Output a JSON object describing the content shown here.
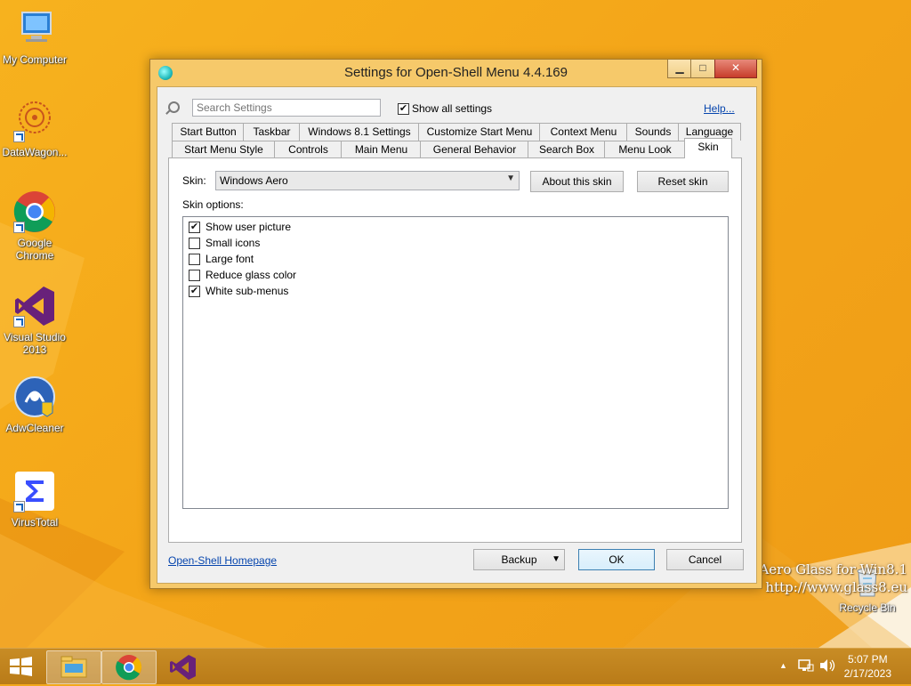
{
  "desktop": {
    "icons": [
      {
        "name": "my-computer",
        "label": "My Computer"
      },
      {
        "name": "datawagon",
        "label": "DataWagon..."
      },
      {
        "name": "google-chrome",
        "label": "Google Chrome"
      },
      {
        "name": "visual-studio",
        "label": "Visual Studio 2013"
      },
      {
        "name": "adwcleaner",
        "label": "AdwCleaner"
      },
      {
        "name": "virustotal",
        "label": "VirusTotal"
      },
      {
        "name": "recycle-bin",
        "label": "Recycle Bin"
      }
    ],
    "watermark": {
      "line1": "Aero Glass for Win8.1",
      "line2": "http://www.glass8.eu"
    }
  },
  "window": {
    "title": "Settings for Open-Shell Menu 4.4.169",
    "controls": {
      "minimize": "▁",
      "maximize": "□",
      "close": "✕"
    },
    "search": {
      "placeholder": "Search Settings",
      "value": ""
    },
    "show_all": {
      "label": "Show all settings",
      "checked": true
    },
    "help_link": "Help...",
    "tabs_row1": [
      "Start Button",
      "Taskbar",
      "Windows 8.1 Settings",
      "Customize Start Menu",
      "Context Menu",
      "Sounds",
      "Language"
    ],
    "tabs_row2": [
      "Start Menu Style",
      "Controls",
      "Main Menu",
      "General Behavior",
      "Search Box",
      "Menu Look",
      "Skin"
    ],
    "selected_tab": "Skin",
    "skin": {
      "label": "Skin:",
      "value": "Windows Aero",
      "about_button": "About this skin",
      "reset_button": "Reset skin",
      "options_label": "Skin options:",
      "options": [
        {
          "label": "Show user picture",
          "checked": true
        },
        {
          "label": "Small icons",
          "checked": false
        },
        {
          "label": "Large font",
          "checked": false
        },
        {
          "label": "Reduce glass color",
          "checked": false
        },
        {
          "label": "White sub-menus",
          "checked": true
        }
      ]
    },
    "footer": {
      "homepage_link": "Open-Shell Homepage",
      "backup_button": "Backup",
      "ok_button": "OK",
      "cancel_button": "Cancel"
    }
  },
  "taskbar": {
    "pinned": [
      "file-explorer-icon",
      "chrome-icon",
      "visual-studio-icon"
    ],
    "tray": {
      "chevron": "▲",
      "network": "network-icon",
      "volume": "volume-icon"
    },
    "clock": {
      "time": "5:07 PM",
      "date": "2/17/2023"
    }
  }
}
